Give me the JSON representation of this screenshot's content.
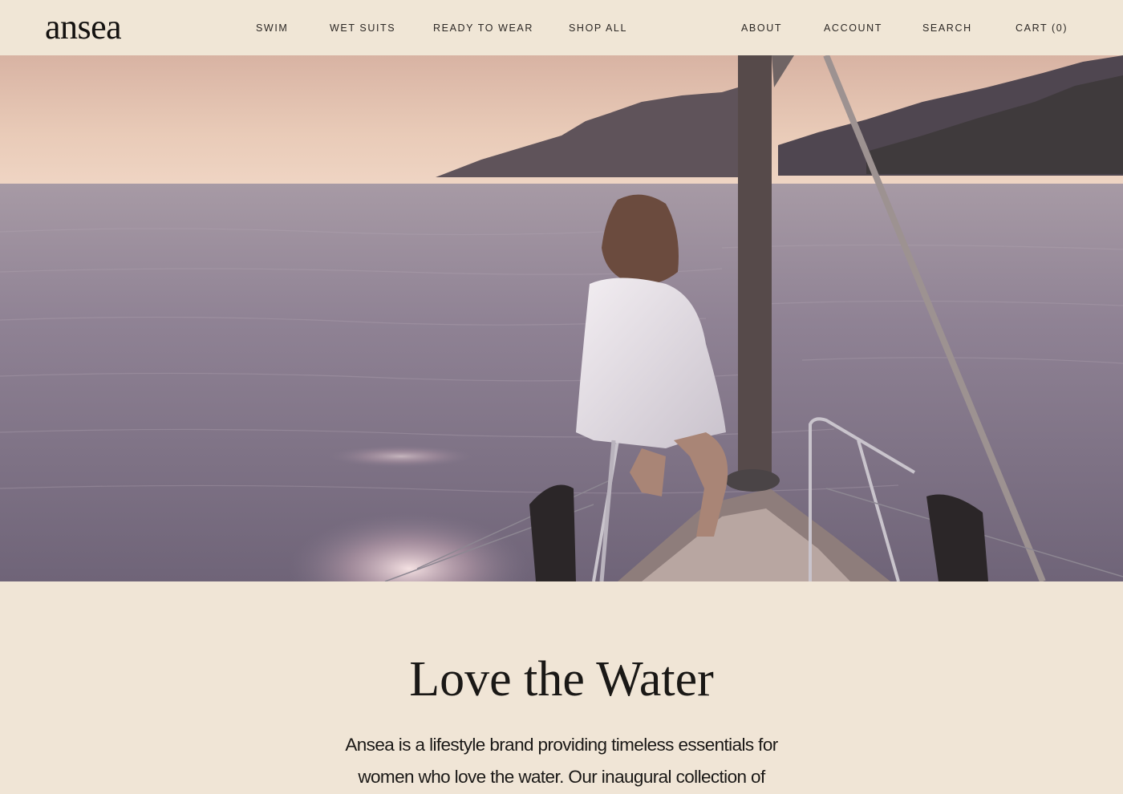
{
  "brand": {
    "logo": "ansea"
  },
  "nav": {
    "left": [
      {
        "label": "SWIM"
      },
      {
        "label": "WET SUITS"
      },
      {
        "label": "READY TO WEAR"
      },
      {
        "label": "SHOP ALL"
      }
    ],
    "right": [
      {
        "label": "ABOUT"
      },
      {
        "label": "ACCOUNT"
      },
      {
        "label": "SEARCH"
      },
      {
        "label": "CART (0)"
      }
    ]
  },
  "content": {
    "headline": "Love the Water",
    "body_line_1": "Ansea is a lifestyle brand providing timeless essentials for",
    "body_line_2": "women who love the water.  Our inaugural collection of"
  },
  "colors": {
    "background": "#f0e5d6",
    "text": "#1d1b19",
    "sky": "#e7c8b8",
    "sea": "#8d7f8c"
  }
}
